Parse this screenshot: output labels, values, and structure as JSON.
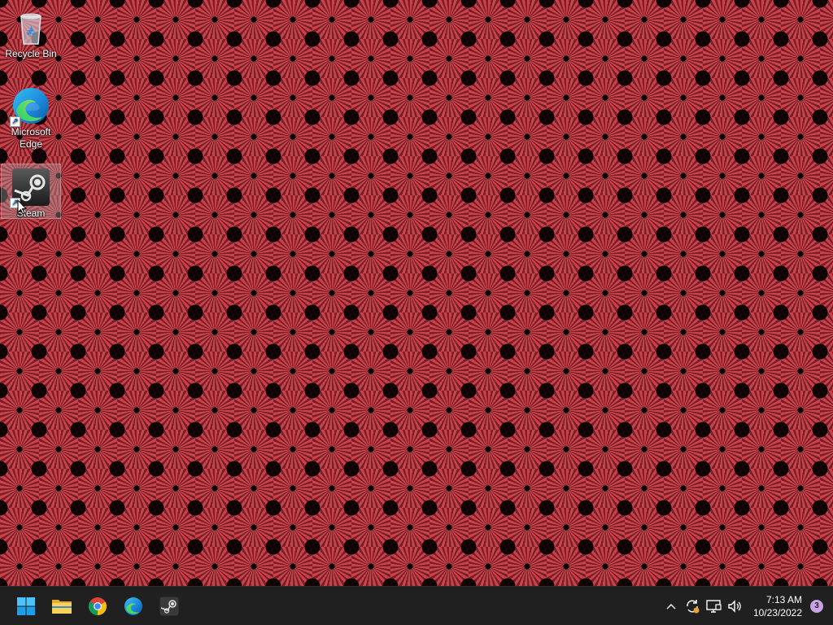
{
  "desktop": {
    "icons": [
      {
        "label": "Recycle Bin",
        "icon": "recycle-bin-icon"
      },
      {
        "label": "Microsoft Edge",
        "icon": "edge-icon"
      },
      {
        "label": "Steam",
        "icon": "steam-icon"
      }
    ]
  },
  "taskbar": {
    "apps": [
      {
        "name": "Start",
        "icon": "windows-start-icon"
      },
      {
        "name": "File Explorer",
        "icon": "folder-icon"
      },
      {
        "name": "Google Chrome",
        "icon": "chrome-icon"
      },
      {
        "name": "Microsoft Edge",
        "icon": "edge-icon"
      },
      {
        "name": "Steam",
        "icon": "steam-icon"
      }
    ],
    "tray": {
      "time": "7:13 AM",
      "date": "10/23/2022",
      "notification_count": "3",
      "icons": [
        "chevron-up-icon",
        "sync-update-icon",
        "network-icon",
        "volume-icon"
      ]
    }
  },
  "colors": {
    "taskbar_bg": "#202020",
    "wallpaper_red": "#c9434a",
    "windows_blue": "#0078d4"
  }
}
